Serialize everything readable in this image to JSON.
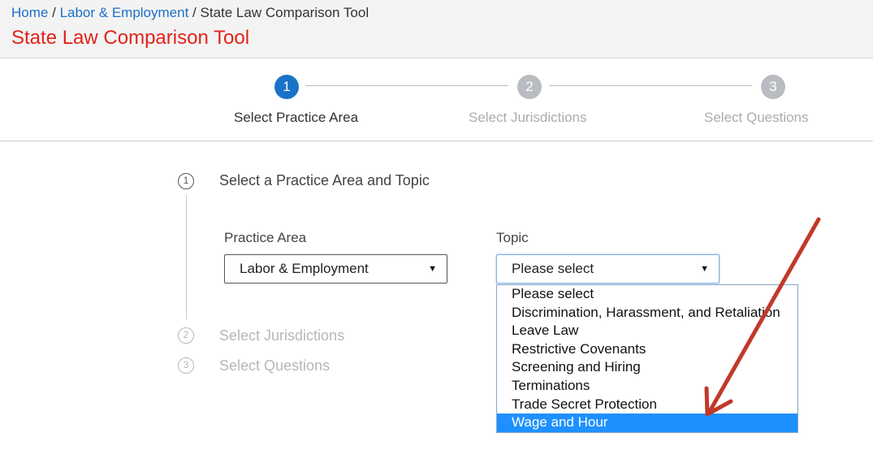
{
  "breadcrumb": {
    "home": "Home",
    "labor": "Labor & Employment",
    "current": "State Law Comparison Tool",
    "separator": "/"
  },
  "page_title": "State Law Comparison Tool",
  "stepper": {
    "steps": [
      {
        "number": "1",
        "label": "Select Practice Area",
        "state": "active"
      },
      {
        "number": "2",
        "label": "Select Jurisdictions",
        "state": "inactive"
      },
      {
        "number": "3",
        "label": "Select Questions",
        "state": "inactive"
      }
    ]
  },
  "sections": [
    {
      "number": "1",
      "title": "Select a Practice Area and Topic"
    },
    {
      "number": "2",
      "title": "Select Jurisdictions"
    },
    {
      "number": "3",
      "title": "Select Questions"
    }
  ],
  "practice_area": {
    "label": "Practice Area",
    "value": "Labor & Employment"
  },
  "topic": {
    "label": "Topic",
    "value": "Please select",
    "options": [
      "Please select",
      "Discrimination, Harassment, and Retaliation",
      "Leave Law",
      "Restrictive Covenants",
      "Screening and Hiring",
      "Terminations",
      "Trade Secret Protection",
      "Wage and Hour"
    ],
    "highlighted": "Wage and Hour"
  },
  "colors": {
    "accent": "#1a73c8",
    "title_red": "#e2231a",
    "highlight": "#1e90ff",
    "annotation_arrow": "#c0392b"
  },
  "icons": {
    "caret": "caret-down-icon",
    "annotation": "arrow-annotation-icon"
  }
}
